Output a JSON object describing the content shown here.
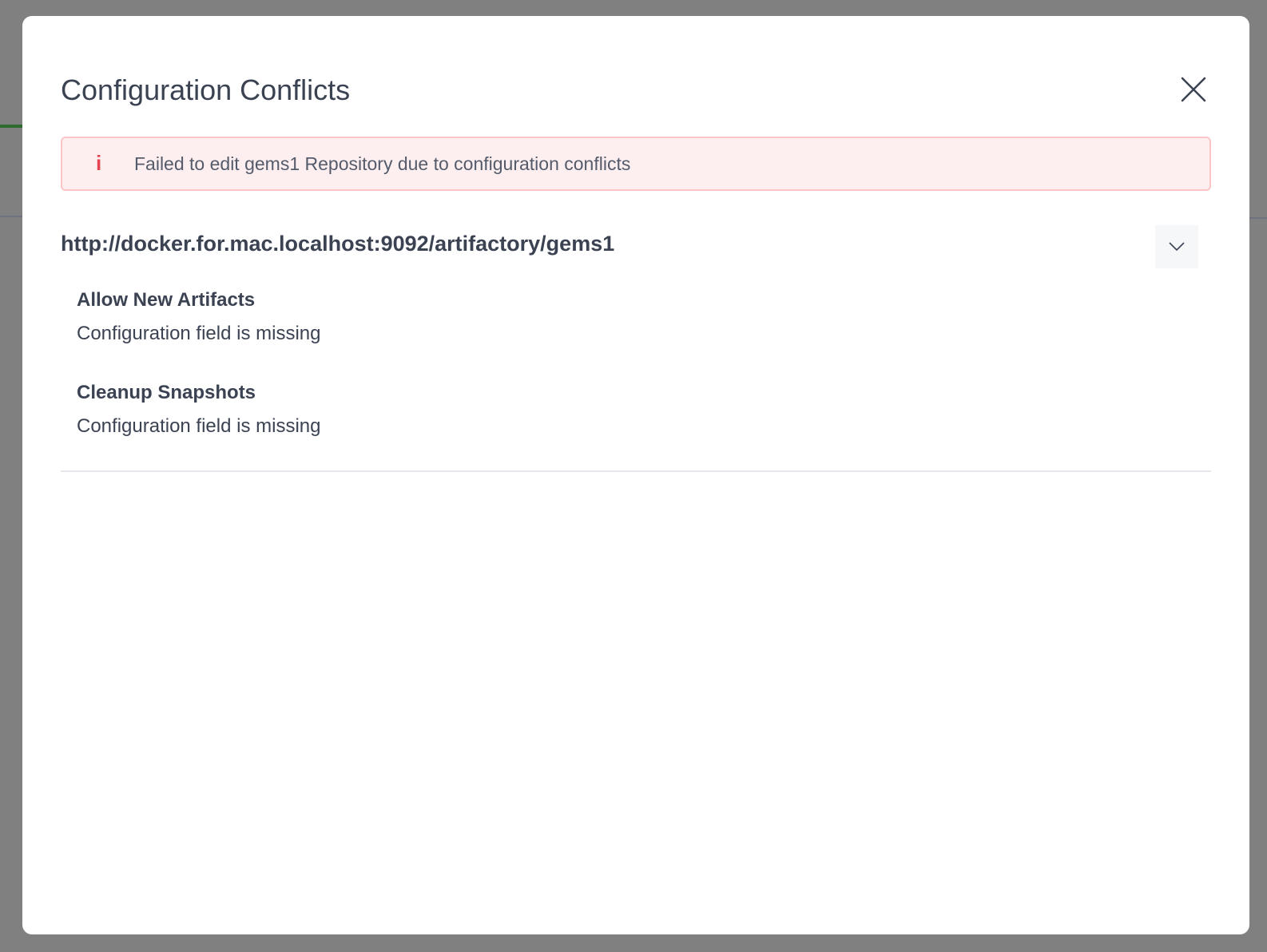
{
  "dialog": {
    "title": "Configuration Conflicts",
    "close_icon": "close-icon",
    "alert": {
      "icon": "info-icon",
      "message": "Failed to edit gems1 Repository due to configuration conflicts",
      "color": "#e5434f"
    },
    "conflict_group": {
      "url": "http://docker.for.mac.localhost:9092/artifactory/gems1",
      "toggle_icon": "chevron-down-icon",
      "fields": [
        {
          "name": "Allow New Artifacts",
          "message": "Configuration field is missing"
        },
        {
          "name": "Cleanup Snapshots",
          "message": "Configuration field is missing"
        }
      ]
    }
  }
}
